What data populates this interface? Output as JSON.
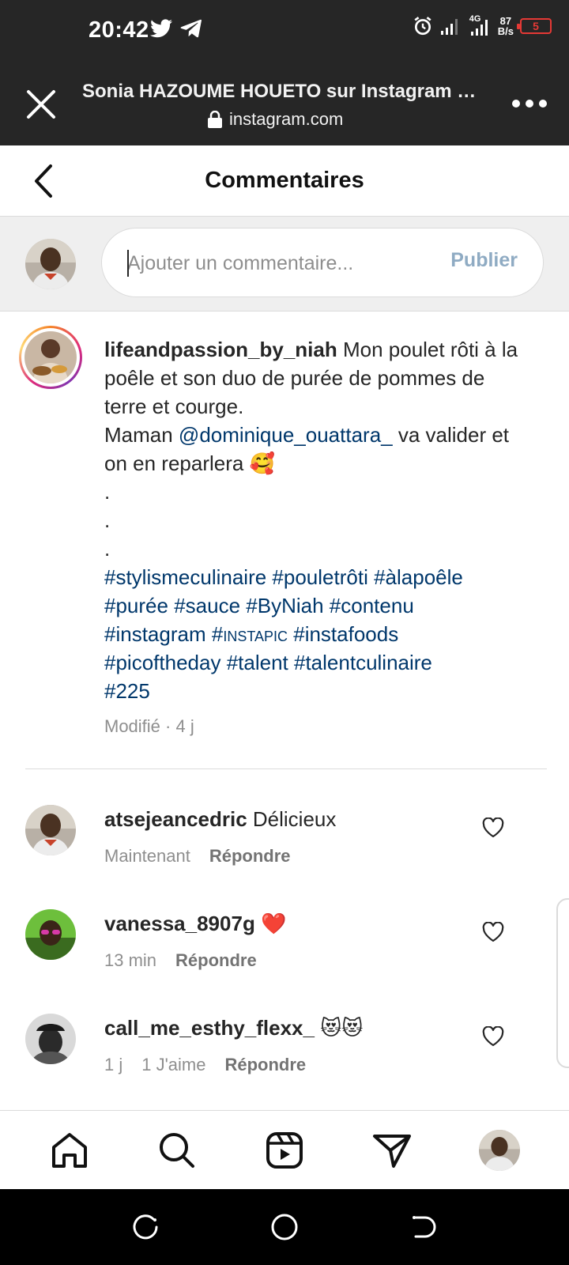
{
  "status_bar": {
    "time": "20:42",
    "left_icons": [
      "twitter-icon",
      "telegram-icon"
    ],
    "right_icons": [
      "alarm-icon",
      "signal-icon",
      "4g-signal-icon"
    ],
    "network_label_top": "4G",
    "net_speed_value": "87",
    "net_speed_unit": "B/s",
    "battery": "5"
  },
  "browser": {
    "title": "Sonia HAZOUME HOUETO sur Instagram :...",
    "url": "instagram.com"
  },
  "header": {
    "title": "Commentaires"
  },
  "composer": {
    "placeholder": "Ajouter un commentaire...",
    "value": "",
    "publish_label": "Publier"
  },
  "caption": {
    "username": "lifeandpassion_by_niah",
    "text_1": " Mon poulet rôti à la poêle et son duo de purée de pommes de terre et courge.",
    "text_2a": "Maman ",
    "mention": "@dominique_ouattara_",
    "text_2b": " va valider et on en reparlera 🥰",
    "dots": [
      ".",
      ".",
      "."
    ],
    "hashtags": [
      "#stylismeculinaire",
      "#pouletrôti",
      "#àlapoêle",
      "#purée",
      "#sauce",
      "#ByNiah",
      "#contenu",
      "#instagram",
      "#instapic",
      "#instafoods",
      "#picoftheday",
      "#talent",
      "#talentculinaire",
      "#225"
    ],
    "meta": "Modifié · 4 j"
  },
  "comments": [
    {
      "username": "atsejeancedric",
      "text": " Délicieux",
      "time": "Maintenant",
      "likes": "",
      "reply": "Répondre"
    },
    {
      "username": "vanessa_8907g",
      "text": " ❤️",
      "time": "13 min",
      "likes": "",
      "reply": "Répondre"
    },
    {
      "username": "call_me_esthy_flexx_",
      "text": " 😻😻",
      "time": "1 j",
      "likes": "1 J'aime",
      "reply": "Répondre"
    }
  ],
  "tabbar": [
    "home-icon",
    "search-icon",
    "reels-icon",
    "direct-icon",
    "profile-avatar"
  ],
  "colors": {
    "dark_bar": "#262626",
    "link": "#00376b",
    "publish_disabled": "#8fabc3",
    "battery_low": "#e53935"
  }
}
